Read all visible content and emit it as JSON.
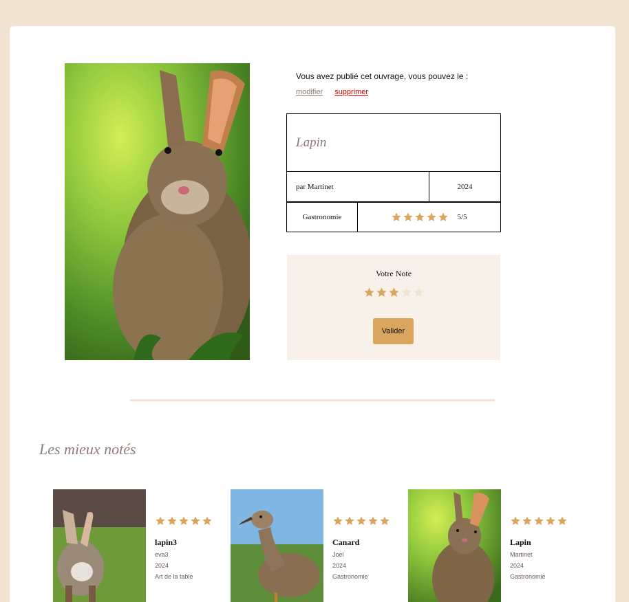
{
  "owner": {
    "message": "Vous avez publié cet ouvrage, vous pouvez le :",
    "edit_label": "modifier",
    "delete_label": "supprimer"
  },
  "book": {
    "title": "Lapin",
    "author_line": "par Martinet",
    "year": "2024",
    "category": "Gastronomie",
    "rating_text": "5/5",
    "rating_value": 5,
    "image": "rabbit-photo"
  },
  "vote": {
    "label": "Votre Note",
    "selected": 3,
    "max": 5,
    "submit_label": "Valider"
  },
  "top_rated": {
    "title": "Les mieux notés",
    "items": [
      {
        "name": "lapin3",
        "author": "eva3",
        "year": "2024",
        "category": "Art de la table",
        "rating": 5,
        "image": "rabbit-back-photo"
      },
      {
        "name": "Canard",
        "author": "Joel",
        "year": "2024",
        "category": "Gastronomie",
        "rating": 5,
        "image": "duck-photo"
      },
      {
        "name": "Lapin",
        "author": "Martinet",
        "year": "2024",
        "category": "Gastronomie",
        "rating": 5,
        "image": "rabbit-photo"
      }
    ]
  },
  "colors": {
    "page_bg": "#f2e4d2",
    "star_filled": "#d9a55f",
    "star_empty": "#f0e2cf",
    "title_color": "#8d7b74",
    "button_bg": "#d9a55f",
    "delete_link": "#c40000"
  }
}
